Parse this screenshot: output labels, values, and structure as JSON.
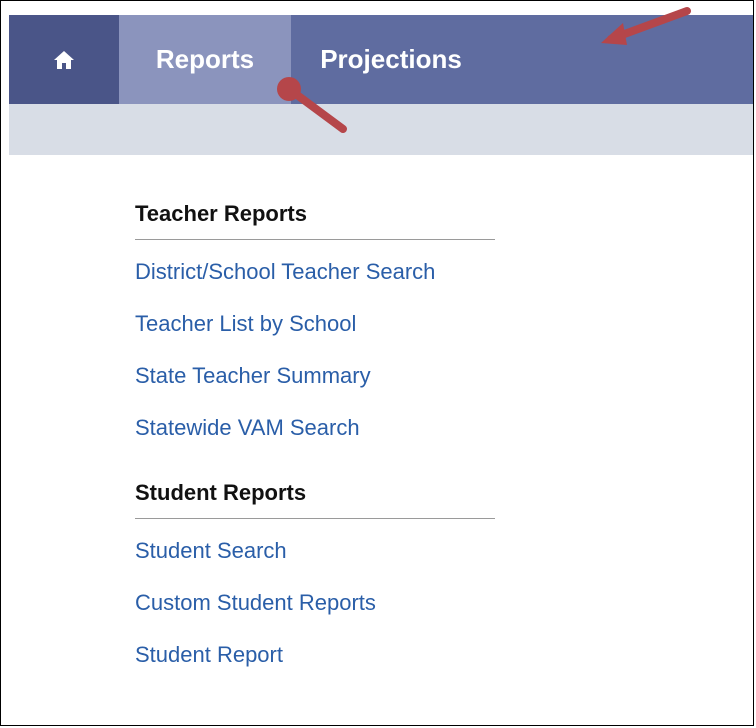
{
  "nav": {
    "home_icon": "home-icon",
    "tabs": [
      {
        "label": "Reports",
        "active": true
      },
      {
        "label": "Projections",
        "active": false
      }
    ],
    "colors": {
      "bar": "#5f6ca0",
      "home_bg": "#4a5588",
      "active_tab": "#8b94bd"
    }
  },
  "sections": [
    {
      "heading": "Teacher Reports",
      "links": [
        "District/School Teacher Search",
        "Teacher List by School",
        "State Teacher Summary",
        "Statewide VAM Search"
      ]
    },
    {
      "heading": "Student Reports",
      "links": [
        "Student Search",
        "Custom Student Reports",
        "Student Report"
      ]
    }
  ],
  "annotations": {
    "arrow_color": "#b5464a"
  },
  "colors": {
    "link": "#2a5ea8",
    "subbar": "#d8dde6"
  }
}
